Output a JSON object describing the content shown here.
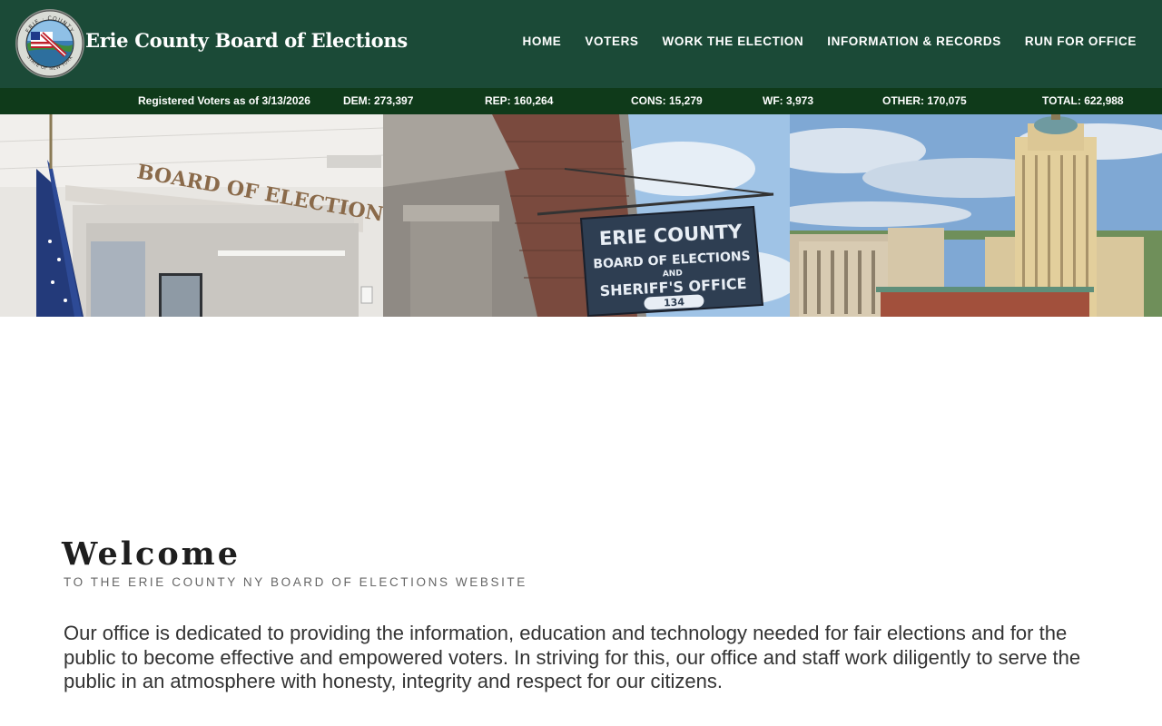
{
  "header": {
    "title": "Erie County Board of Elections",
    "seal_icon": "county-seal-icon",
    "seal_text": [
      "ERIE",
      "COUNTY",
      "STATE OF NEW YORK"
    ],
    "nav": [
      "HOME",
      "VOTERS",
      "WORK THE ELECTION",
      "INFORMATION & RECORDS",
      "RUN FOR OFFICE"
    ]
  },
  "stats": {
    "heading": "Registered Voters as of 3/13/2026",
    "dem": "DEM:   273,397",
    "rep": "REP:   160,264",
    "cons": "CONS:   15,279",
    "wf": "WF:  3,973",
    "other": "OTHER:  170,075",
    "total": "TOTAL:  622,988"
  },
  "hero": {
    "lobby_sign": "BOARD OF ELECTIONS",
    "street_sign": [
      "ERIE COUNTY",
      "BOARD OF ELECTIONS",
      "AND",
      "SHERIFF'S OFFICE"
    ],
    "street_sign_number": "134"
  },
  "welcome": {
    "title": "Welcome",
    "subtitle": "TO THE ERIE COUNTY NY BOARD OF ELECTIONS WEBSITE",
    "body": "Our office is dedicated to providing the information, education and technology needed for fair elections and for the public to become effective and empowered voters. In striving for this, our office and staff work diligently to serve the public in an atmosphere with honesty, integrity and respect for our citizens."
  },
  "colors": {
    "header_bg": "#1b4a37",
    "stats_bg": "#0f3a1a",
    "text": "#333333"
  }
}
